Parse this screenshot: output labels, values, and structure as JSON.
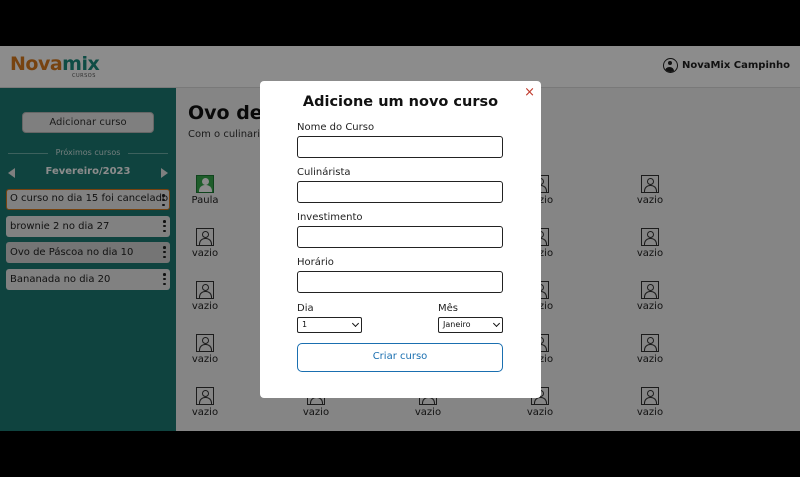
{
  "header": {
    "logo_part1": "Nova",
    "logo_part2": "mix",
    "logo_sub": "CURSOS",
    "user_name": "NovaMix Campinho"
  },
  "sidebar": {
    "add_button": "Adicionar curso",
    "next_label": "Próximos cursos",
    "month": "Fevereiro/2023",
    "courses": [
      {
        "label": "O curso no dia 15 foi cancelado"
      },
      {
        "label": "brownie 2 no dia 27"
      },
      {
        "label": "Ovo de Páscoa no dia 10"
      },
      {
        "label": "Bananada no dia 20"
      }
    ]
  },
  "main": {
    "title": "Ovo de",
    "subtitle": "Com o culinaris",
    "slots": [
      {
        "label": "Paula"
      },
      {
        "label": "vazio"
      },
      {
        "label": "vazio"
      },
      {
        "label": "vazio"
      },
      {
        "label": "vazio"
      },
      {
        "label": "vazio"
      },
      {
        "label": "vazio"
      },
      {
        "label": "vazio"
      },
      {
        "label": "vazio"
      },
      {
        "label": "vazio"
      },
      {
        "label": "vazio"
      },
      {
        "label": "vazio"
      },
      {
        "label": "vazio"
      },
      {
        "label": "vazio"
      },
      {
        "label": "vazio"
      },
      {
        "label": "vazio"
      },
      {
        "label": "vazio"
      },
      {
        "label": "vazio"
      }
    ]
  },
  "modal": {
    "title": "Adicione um novo curso",
    "close": "×",
    "fields": [
      {
        "label": "Nome do Curso",
        "value": ""
      },
      {
        "label": "Culinárista",
        "value": ""
      },
      {
        "label": "Investimento",
        "value": ""
      },
      {
        "label": "Horário",
        "value": ""
      }
    ],
    "day_label": "Dia",
    "day_value": "1",
    "month_label": "Mês",
    "month_value": "Janeiro",
    "submit": "Criar curso"
  }
}
